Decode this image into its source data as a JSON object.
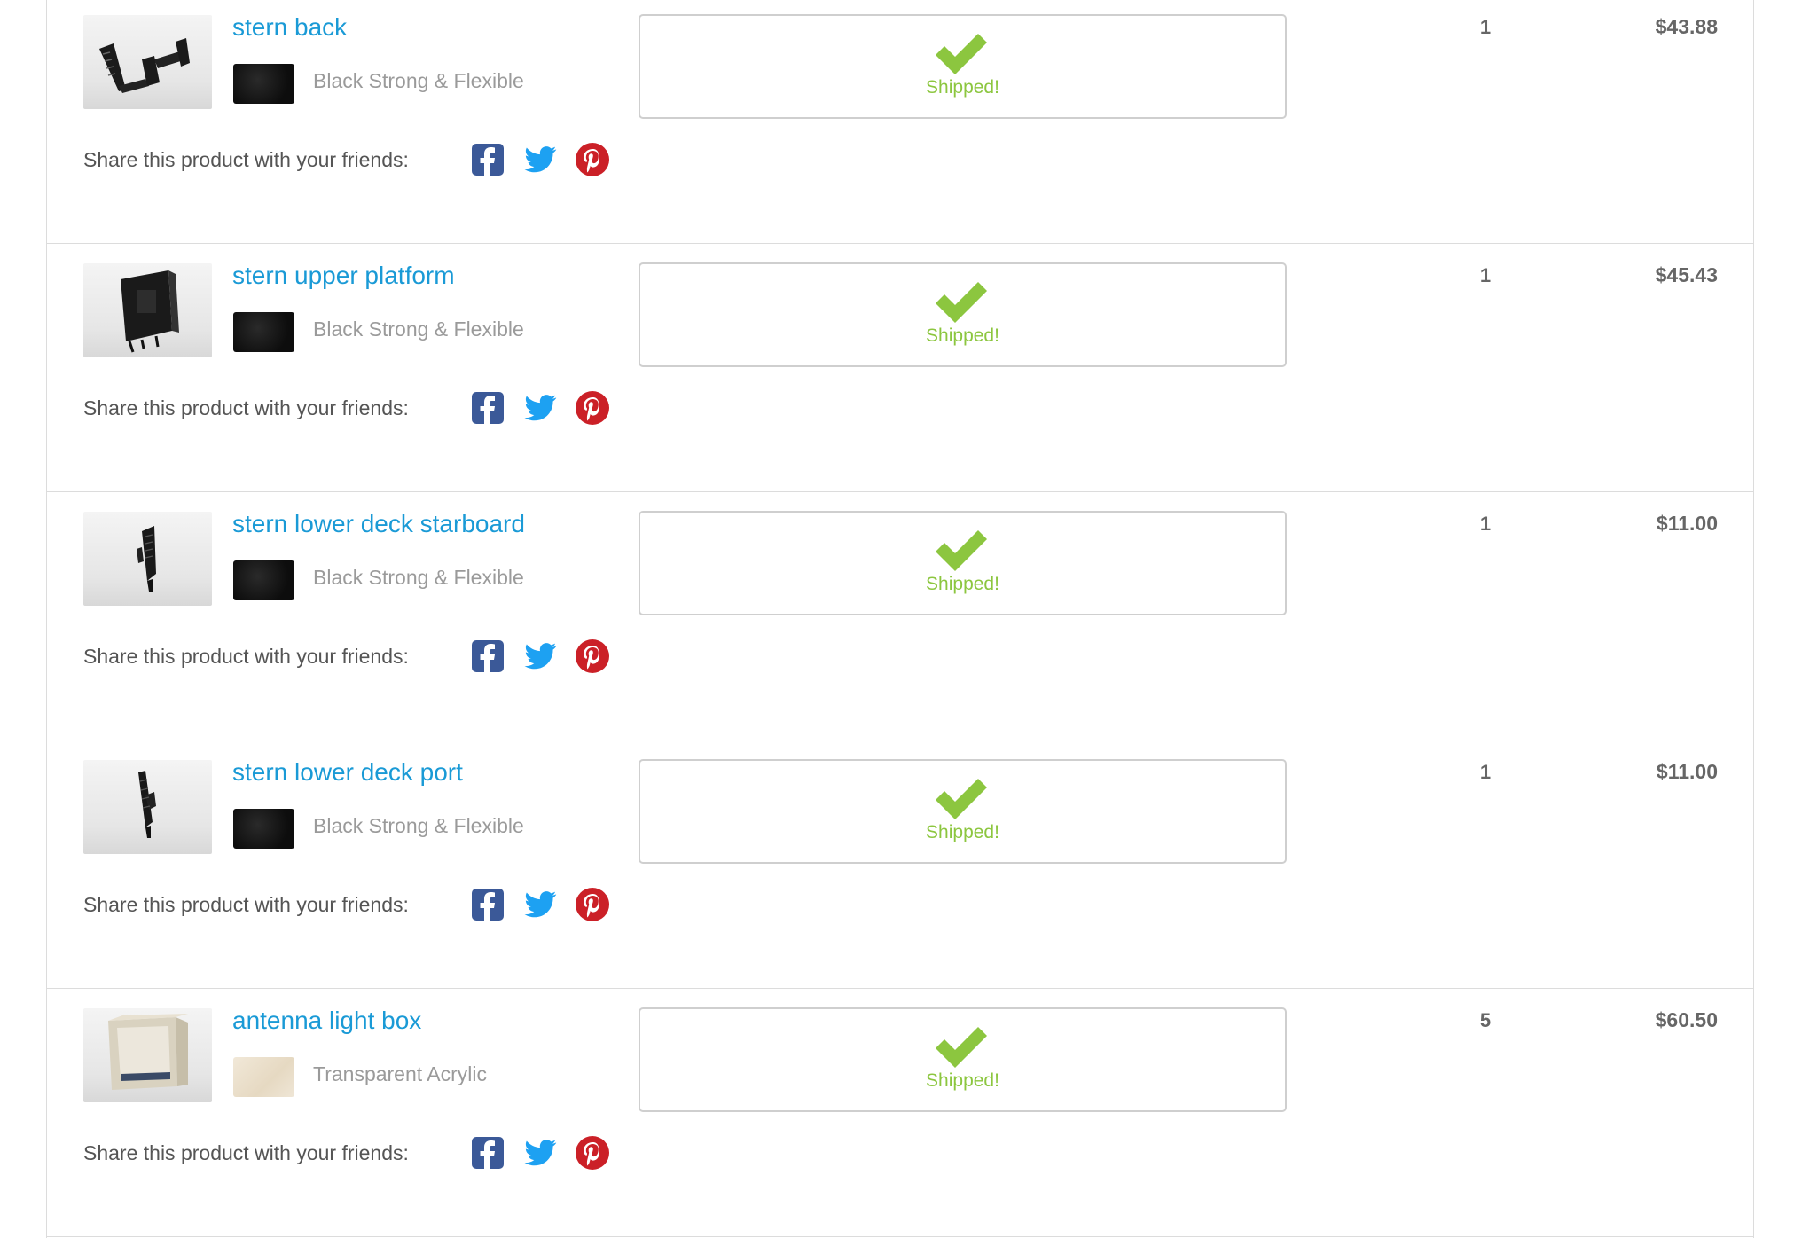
{
  "share_label": "Share this product with your friends:",
  "status_label": "Shipped!",
  "colors": {
    "link": "#1a9ad6",
    "shipped": "#8cc63f",
    "facebook": "#3b5998",
    "twitter": "#1da1f2",
    "pinterest": "#cb2027"
  },
  "items": [
    {
      "name": "stern back",
      "material": "Black Strong & Flexible",
      "quantity": "1",
      "price": "$43.88",
      "swatch": "black",
      "thumb_icon": "stern-back-part-icon"
    },
    {
      "name": "stern upper platform",
      "material": "Black Strong & Flexible",
      "quantity": "1",
      "price": "$45.43",
      "swatch": "black",
      "thumb_icon": "stern-upper-platform-part-icon"
    },
    {
      "name": "stern lower deck starboard",
      "material": "Black Strong & Flexible",
      "quantity": "1",
      "price": "$11.00",
      "swatch": "black",
      "thumb_icon": "stern-lower-deck-starboard-part-icon"
    },
    {
      "name": "stern lower deck port",
      "material": "Black Strong & Flexible",
      "quantity": "1",
      "price": "$11.00",
      "swatch": "black",
      "thumb_icon": "stern-lower-deck-port-part-icon"
    },
    {
      "name": "antenna light box",
      "material": "Transparent Acrylic",
      "quantity": "5",
      "price": "$60.50",
      "swatch": "acrylic",
      "thumb_icon": "antenna-light-box-part-icon"
    }
  ]
}
